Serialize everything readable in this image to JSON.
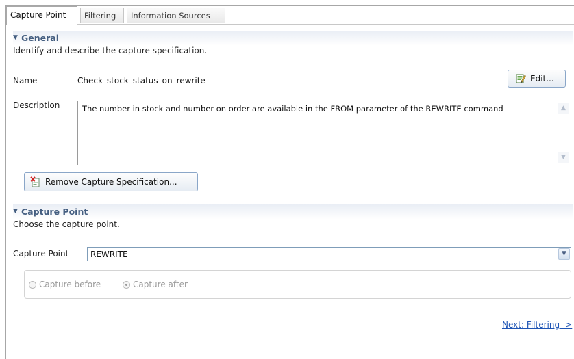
{
  "tabs": [
    {
      "label": "Capture Point",
      "active": true
    },
    {
      "label": "Filtering",
      "active": false
    },
    {
      "label": "Information Sources",
      "active": false
    }
  ],
  "general": {
    "title": "General",
    "description": "Identify and describe the capture specification.",
    "name_label": "Name",
    "name_value": "Check_stock_status_on_rewrite",
    "edit_button": "Edit...",
    "description_label": "Description",
    "description_value": "The number in stock and number on order are available in the FROM parameter of the REWRITE command",
    "remove_button": "Remove Capture Specification..."
  },
  "capture_point": {
    "title": "Capture Point",
    "description": "Choose the capture point.",
    "field_label": "Capture Point",
    "selected": "REWRITE",
    "radio_before": "Capture before",
    "radio_after": "Capture after",
    "selected_radio": "after"
  },
  "footer": {
    "next_link": "Next: Filtering ->"
  },
  "icons": {
    "section_toggle": "triangle-down-icon",
    "edit": "edit-document-icon",
    "remove": "remove-spec-icon",
    "dropdown": "chevron-down-icon"
  }
}
